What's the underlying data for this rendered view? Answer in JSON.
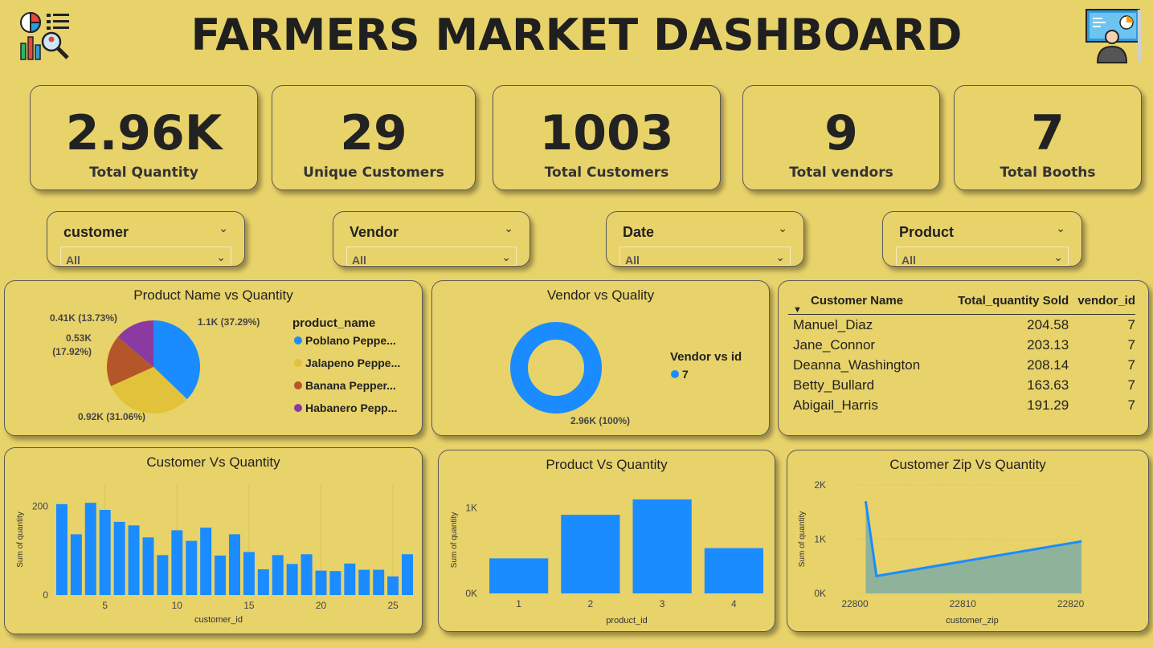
{
  "header": {
    "title": "FARMERS MARKET DASHBOARD"
  },
  "kpis": [
    {
      "value": "2.96K",
      "label": "Total Quantity"
    },
    {
      "value": "29",
      "label": "Unique Customers"
    },
    {
      "value": "1003",
      "label": "Total Customers"
    },
    {
      "value": "9",
      "label": "Total vendors"
    },
    {
      "value": "7",
      "label": "Total Booths"
    }
  ],
  "slicers": [
    {
      "title": "customer",
      "value": "All"
    },
    {
      "title": "Vendor",
      "value": "All"
    },
    {
      "title": "Date",
      "value": "All"
    },
    {
      "title": "Product",
      "value": "All"
    }
  ],
  "colors": {
    "background": "#e8d26a",
    "blue": "#1a8cff",
    "yellow": "#e2c23a",
    "rust": "#b5562a",
    "purple": "#8a3aa0",
    "area": "#8fb39a"
  },
  "table": {
    "columns": [
      "Customer Name",
      "Total_quantity Sold",
      "vendor_id"
    ],
    "rows": [
      [
        "Manuel_Diaz",
        "204.58",
        "7"
      ],
      [
        "Jane_Connor",
        "203.13",
        "7"
      ],
      [
        "Deanna_Washington",
        "208.14",
        "7"
      ],
      [
        "Betty_Bullard",
        "163.63",
        "7"
      ],
      [
        "Abigail_Harris",
        "191.29",
        "7"
      ]
    ]
  },
  "chart_data": [
    {
      "type": "pie",
      "title": "Product Name vs Quantity",
      "legend_title": "product_name",
      "legend_position": "right",
      "slices": [
        {
          "name": "Poblano Peppe...",
          "value": 1.1,
          "label": "1.1K (37.29%)",
          "percent": 37.29
        },
        {
          "name": "Jalapeno Peppe...",
          "value": 0.92,
          "label": "0.92K (31.06%)",
          "percent": 31.06
        },
        {
          "name": "Banana Pepper...",
          "value": 0.53,
          "label": "0.53K (17.92%)",
          "percent": 17.92
        },
        {
          "name": "Habanero Pepp...",
          "value": 0.41,
          "label": "0.41K (13.73%)",
          "percent": 13.73
        }
      ]
    },
    {
      "type": "pie",
      "title": "Vendor vs Quality",
      "legend_title": "Vendor vs id",
      "legend_position": "right",
      "slices": [
        {
          "name": "7",
          "value": 2.96,
          "label": "2.96K (100%)",
          "percent": 100
        }
      ]
    },
    {
      "type": "bar",
      "title": "Customer Vs Quantity",
      "xlabel": "customer_id",
      "ylabel": "Sum of quantity",
      "x": [
        2,
        3,
        4,
        5,
        6,
        7,
        8,
        9,
        10,
        11,
        12,
        13,
        14,
        15,
        16,
        17,
        18,
        19,
        20,
        21,
        22,
        23,
        24,
        25,
        26
      ],
      "values": [
        205,
        137,
        208,
        192,
        165,
        157,
        130,
        90,
        146,
        122,
        152,
        89,
        137,
        97,
        58,
        90,
        70,
        92,
        55,
        54,
        71,
        57,
        57,
        42,
        92
      ],
      "xticks": [
        5,
        10,
        15,
        20,
        25
      ],
      "yticks": [
        0,
        200
      ],
      "ylim": [
        0,
        250
      ]
    },
    {
      "type": "bar",
      "title": "Product Vs Quantity",
      "xlabel": "product_id",
      "ylabel": "Sum of quantity",
      "categories": [
        "1",
        "2",
        "3",
        "4"
      ],
      "values": [
        410,
        920,
        1100,
        530
      ],
      "yticks": [
        "0K",
        "1K"
      ],
      "ylim": [
        0,
        1250
      ]
    },
    {
      "type": "area",
      "title": "Customer Zip Vs Quantity",
      "xlabel": "customer_zip",
      "ylabel": "Sum of quantity",
      "x": [
        22801,
        22802,
        22821
      ],
      "values": [
        1700,
        320,
        960
      ],
      "xticks": [
        22800,
        22810,
        22820
      ],
      "yticks": [
        "0K",
        "1K",
        "2K"
      ],
      "xlim": [
        22800,
        22821
      ],
      "ylim": [
        0,
        2000
      ]
    }
  ]
}
